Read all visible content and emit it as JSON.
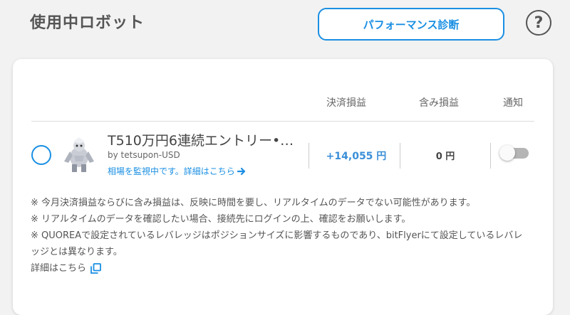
{
  "header": {
    "title": "使用中ロボット",
    "performance_button": "パフォーマンス診断",
    "help_label": "?"
  },
  "table": {
    "columns": [
      "決済損益",
      "含み損益",
      "通知"
    ]
  },
  "robot": {
    "name": "T510万円6連続エントリー•…",
    "by": "by tetsupon-USD",
    "monitor_link": "相場を監視中です。詳細はこちら",
    "settled_pnl": "+14,055 円",
    "unrealized_pnl": "0 円",
    "notify_enabled": false
  },
  "notes": {
    "line1": "※ 今月決済損益ならびに含み損益は、反映に時間を要し、リアルタイムのデータでない可能性があります。",
    "line2": "※ リアルタイムのデータを確認したい場合、接続先にログインの上、確認をお願いします。",
    "line3": "※ QUOREAで設定されているレバレッジはポジションサイズに影響するものであり、bitFlyerにて設定しているレバレッジとは異なります。",
    "details_link": "詳細はこちら"
  },
  "colors": {
    "accent": "#1a8fe3",
    "settled_text": "#3a8fd8",
    "toggle_off": "#b5b5b5"
  }
}
